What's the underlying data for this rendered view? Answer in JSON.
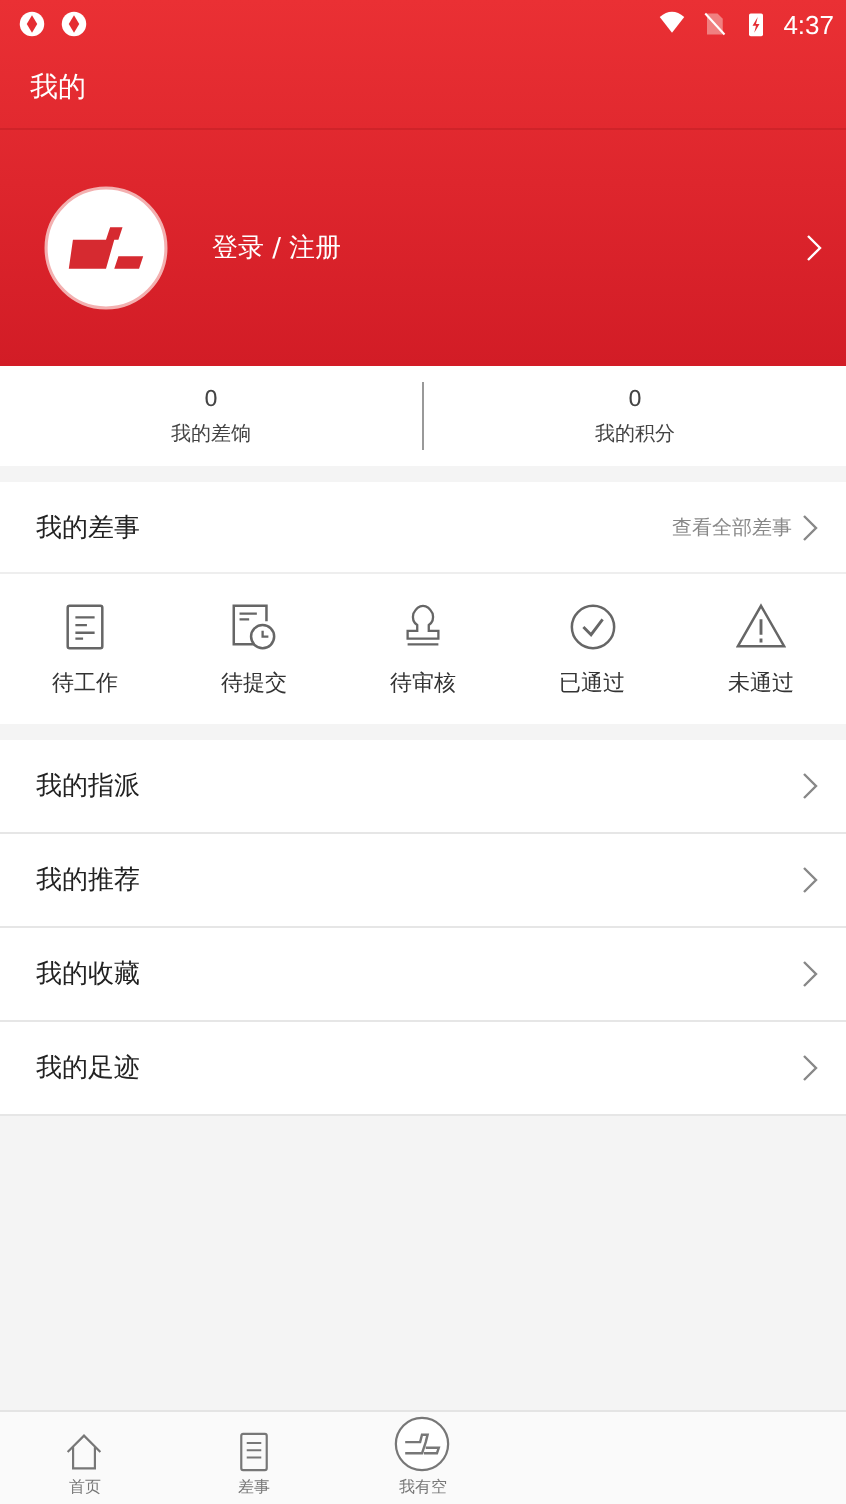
{
  "status_bar": {
    "time": "4:37"
  },
  "header": {
    "title": "我的"
  },
  "profile": {
    "login_text": "登录 / 注册"
  },
  "stats": [
    {
      "value": "0",
      "label": "我的差饷"
    },
    {
      "value": "0",
      "label": "我的积分"
    }
  ],
  "tasks": {
    "title": "我的差事",
    "link": "查看全部差事",
    "items": [
      {
        "kind": "doc",
        "label": "待工作"
      },
      {
        "kind": "clock",
        "label": "待提交"
      },
      {
        "kind": "stamp",
        "label": "待审核"
      },
      {
        "kind": "check",
        "label": "已通过"
      },
      {
        "kind": "warn",
        "label": "未通过"
      }
    ]
  },
  "menu": [
    {
      "label": "我的指派"
    },
    {
      "label": "我的推荐"
    },
    {
      "label": "我的收藏"
    },
    {
      "label": "我的足迹"
    }
  ],
  "bottom_nav": [
    {
      "kind": "home",
      "label": "首页"
    },
    {
      "kind": "list",
      "label": "差事"
    },
    {
      "kind": "logo",
      "label": "我有空"
    }
  ]
}
